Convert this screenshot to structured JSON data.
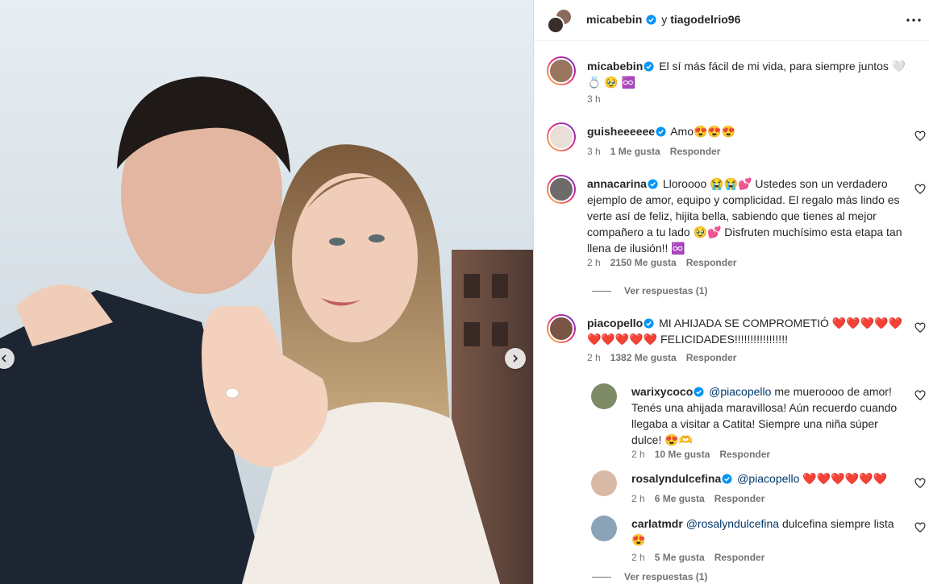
{
  "post": {
    "author": "micabebin",
    "coauthor_joiner": "y",
    "coauthor": "tiagodelrio96"
  },
  "caption": {
    "username": "micabebin",
    "text": "El sí más fácil de mi vida, para siempre juntos 🤍 💍 🥹 ♾️",
    "time": "3 h"
  },
  "comments": [
    {
      "username": "guisheeeeee",
      "text": "Amo😍😍😍",
      "time": "3 h",
      "likes": "1 Me gusta",
      "reply": "Responder"
    },
    {
      "username": "annacarina",
      "text": "Lloroooo 😭😭💕 Ustedes son un verdadero ejemplo de amor, equipo y complicidad. El regalo más lindo es verte así de feliz, hijita bella, sabiendo que tienes al mejor compañero a tu lado 🥹💕 Disfruten muchísimo esta etapa tan llena de ilusión!! ♾️",
      "time": "2 h",
      "likes": "2150 Me gusta",
      "reply": "Responder",
      "view_replies": "Ver respuestas (1)"
    },
    {
      "username": "piacopello",
      "text": "MI AHIJADA SE COMPROMETIÓ ❤️❤️❤️❤️❤️ ❤️❤️❤️❤️❤️ FELICIDADES!!!!!!!!!!!!!!!!!",
      "time": "2 h",
      "likes": "1382 Me gusta",
      "reply": "Responder"
    }
  ],
  "replies": [
    {
      "username": "warixycoco",
      "mention": "@piacopello",
      "text": "me mueroooo de amor! Tenés una ahijada maravillosa! Aún recuerdo cuando llegaba a visitar a Catita! Siempre una niña súper dulce! 😍🫶",
      "time": "2 h",
      "likes": "10 Me gusta",
      "reply": "Responder"
    },
    {
      "username": "rosalyndulcefina",
      "mention": "@piacopello",
      "text": "❤️❤️❤️❤️❤️❤️",
      "time": "2 h",
      "likes": "6 Me gusta",
      "reply": "Responder"
    },
    {
      "username": "carlatmdr",
      "mention": "@rosalyndulcefina",
      "text": "dulcefina siempre lista 😍",
      "time": "2 h",
      "likes": "5 Me gusta",
      "reply": "Responder"
    }
  ],
  "footer": {
    "view_replies": "Ver respuestas (1)"
  },
  "colors": {
    "verified": "#0095f6",
    "meta": "#737373",
    "mention": "#00376b",
    "heart_emoji": "#ed1e5b"
  },
  "icons": [
    "verified-badge-icon",
    "more-options-icon",
    "heart-outline-icon",
    "chevron-left-icon",
    "chevron-right-icon"
  ]
}
